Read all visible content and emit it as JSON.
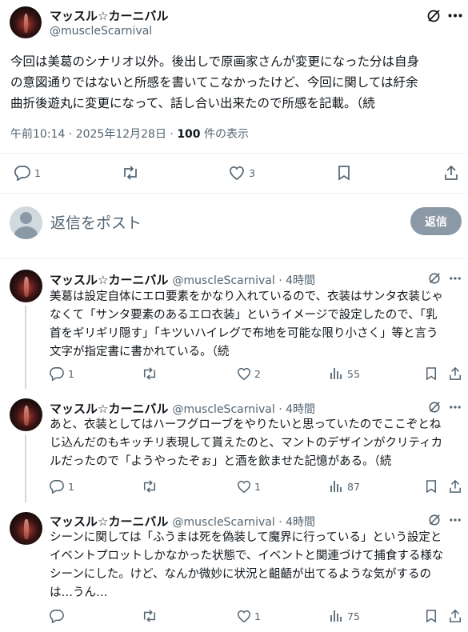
{
  "main_post": {
    "display_name": "マッスル☆カーニバル",
    "handle": "@muscleScarnival",
    "text": "今回は美葛のシナリオ以外。後出しで原画家さんが変更になった分は自身\nの意図通りではないと所感を書いてこなかったけど、今回に関しては紆余\n曲折後遊丸に変更になって、話し合い出来たので所感を記載。（続",
    "timestamp": "午前10:14 · 2025年12月28日 ·",
    "views_count": "100",
    "views_label": " 件の表示",
    "reply_count": "1",
    "retweet_count": "",
    "like_count": "3"
  },
  "composer": {
    "placeholder": "返信をポスト",
    "reply_button": "返信"
  },
  "replies": [
    {
      "display_name": "マッスル☆カーニバル",
      "handle": "@muscleScarnival · 4時間",
      "text": "美葛は設定自体にエロ要素をかなり入れているので、衣装はサンタ衣装じゃ\nなくて「サンタ要素のあるエロ衣装」というイメージで設定したので、「乳\n首をギリギリ隠す」「キツいハイレグで布地を可能な限り小さく」等と言う\n文字が指定書に書かれている。（続",
      "reply_count": "1",
      "like_count": "2",
      "views": "55"
    },
    {
      "display_name": "マッスル☆カーニバル",
      "handle": "@muscleScarnival · 4時間",
      "text": "あと、衣装としてはハーフグローブをやりたいと思っていたのでここぞとね\nじ込んだのもキッチリ表現して貰えたのと、マントのデザインがクリティカ\nルだったので「ようやったぞぉ」と酒を飲ませた記憶がある。（続",
      "reply_count": "1",
      "like_count": "1",
      "views": "87"
    },
    {
      "display_name": "マッスル☆カーニバル",
      "handle": "@muscleScarnival · 4時間",
      "text": "シーンに関しては「ふうまは死を偽装して魔界に行っている」という設定と\nイベントプロットしかなかった状態で、イベントと関連づけて捕食する様な\nシーンにした。けど、なんか微妙に状況と齟齬が出てるような気がするの\nは…うん…",
      "reply_count": "",
      "like_count": "1",
      "views": "75"
    }
  ],
  "colors": {
    "text": "#0f1419",
    "secondary": "#536471",
    "divider": "#eff3f4",
    "reply_button_bg": "#8b98a5"
  }
}
